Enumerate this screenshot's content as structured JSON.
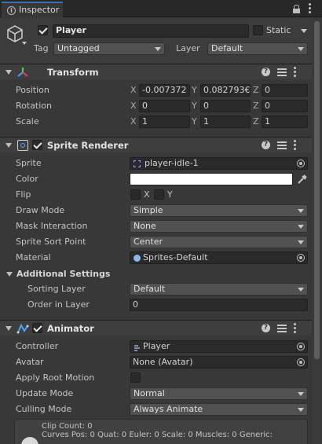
{
  "tab": {
    "label": "Inspector"
  },
  "gameobject": {
    "name": "Player",
    "active": true,
    "static_label": "Static",
    "static": false,
    "tag_label": "Tag",
    "tag_value": "Untagged",
    "layer_label": "Layer",
    "layer_value": "Default"
  },
  "transform": {
    "title": "Transform",
    "rows": [
      {
        "label": "Position",
        "x": "-0.007372",
        "y": "0.082793€",
        "z": "0"
      },
      {
        "label": "Rotation",
        "x": "0",
        "y": "0",
        "z": "0"
      },
      {
        "label": "Scale",
        "x": "1",
        "y": "1",
        "z": "1"
      }
    ],
    "axis": {
      "x": "X",
      "y": "Y",
      "z": "Z"
    }
  },
  "sprite_renderer": {
    "title": "Sprite Renderer",
    "enabled": true,
    "sprite_label": "Sprite",
    "sprite_value": "player-idle-1",
    "color_label": "Color",
    "color_value": "#ffffff",
    "flip_label": "Flip",
    "flip_x": "X",
    "flip_y": "Y",
    "draw_mode_label": "Draw Mode",
    "draw_mode_value": "Simple",
    "mask_label": "Mask Interaction",
    "mask_value": "None",
    "sort_point_label": "Sprite Sort Point",
    "sort_point_value": "Center",
    "material_label": "Material",
    "material_value": "Sprites-Default",
    "additional_title": "Additional Settings",
    "sorting_layer_label": "Sorting Layer",
    "sorting_layer_value": "Default",
    "order_label": "Order in Layer",
    "order_value": "0"
  },
  "animator": {
    "title": "Animator",
    "enabled": true,
    "controller_label": "Controller",
    "controller_value": "Player",
    "avatar_label": "Avatar",
    "avatar_value": "None (Avatar)",
    "root_motion_label": "Apply Root Motion",
    "update_mode_label": "Update Mode",
    "update_mode_value": "Normal",
    "culling_label": "Culling Mode",
    "culling_value": "Always Animate",
    "info_line1": "Clip Count: 0",
    "info_line2": "Curves Pos: 0 Quat: 0 Euler: 0 Scale: 0 Muscles: 0 Generic:"
  },
  "colors": {
    "panel": "#383838",
    "field": "#2a2a2a",
    "dropdown": "#515151",
    "transform_icon": [
      "#5aa0f0",
      "#e04848",
      "#5bc85b"
    ],
    "animator_icon": "#4fa3ff"
  }
}
